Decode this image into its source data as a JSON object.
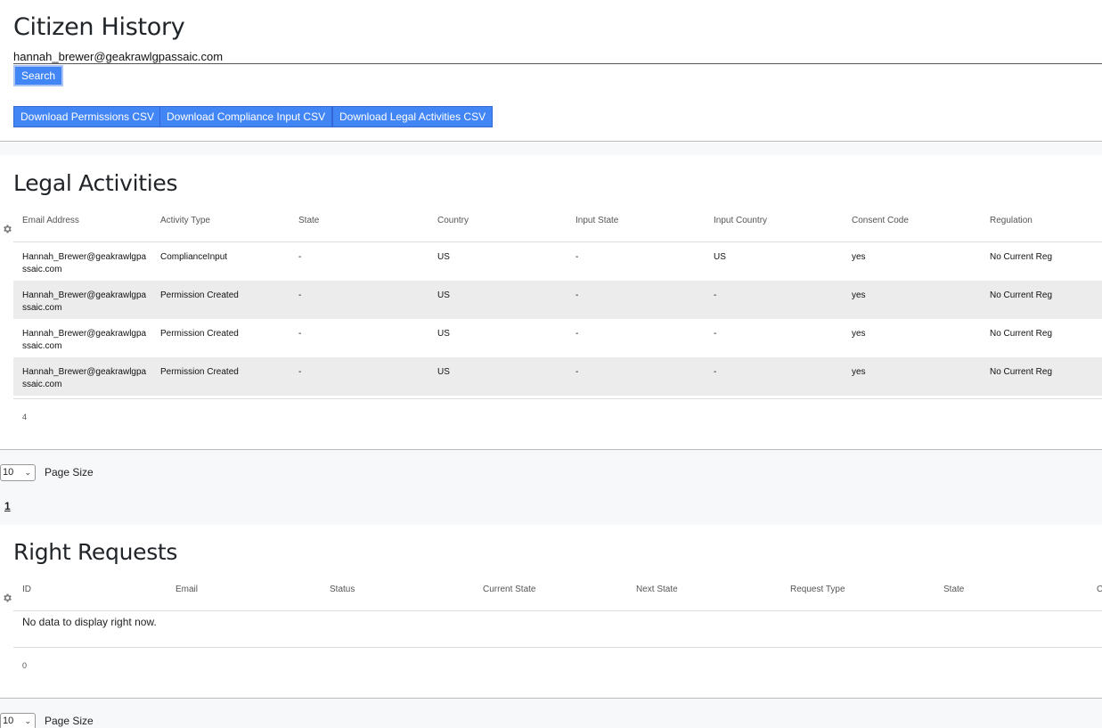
{
  "page": {
    "title": "Citizen History"
  },
  "search": {
    "value": "hannah_brewer@geakrawlgpassaic.com",
    "button_label": "Search"
  },
  "downloads": {
    "permissions": "Download Permissions CSV",
    "compliance": "Download Compliance Input CSV",
    "legal": "Download Legal Activities CSV"
  },
  "legal_activities": {
    "title": "Legal Activities",
    "columns": [
      "Email Address",
      "Activity Type",
      "State",
      "Country",
      "Input State",
      "Input Country",
      "Consent Code",
      "Regulation"
    ],
    "rows": [
      [
        "Hannah_Brewer@geakrawlgpassaic.com",
        "ComplianceInput",
        "-",
        "US",
        "-",
        "US",
        "yes",
        "No Current Reg"
      ],
      [
        "Hannah_Brewer@geakrawlgpassaic.com",
        "Permission Created",
        "-",
        "US",
        "-",
        "-",
        "yes",
        "No Current Reg"
      ],
      [
        "Hannah_Brewer@geakrawlgpassaic.com",
        "Permission Created",
        "-",
        "US",
        "-",
        "-",
        "yes",
        "No Current Reg"
      ],
      [
        "Hannah_Brewer@geakrawlgpassaic.com",
        "Permission Created",
        "-",
        "US",
        "-",
        "-",
        "yes",
        "No Current Reg"
      ]
    ],
    "count": "4",
    "page_size_value": "10",
    "page_size_label": "Page Size",
    "current_page": "1"
  },
  "right_requests": {
    "title": "Right Requests",
    "columns": [
      "ID",
      "Email",
      "Status",
      "Current State",
      "Next State",
      "Request Type",
      "State",
      "C"
    ],
    "empty_message": "No data to display right now.",
    "count": "0",
    "page_size_value": "10",
    "page_size_label": "Page Size"
  },
  "icons": {
    "settings": "gear-icon",
    "dropdown": "chevron-down-icon"
  },
  "colors": {
    "accent": "#4285f4"
  }
}
